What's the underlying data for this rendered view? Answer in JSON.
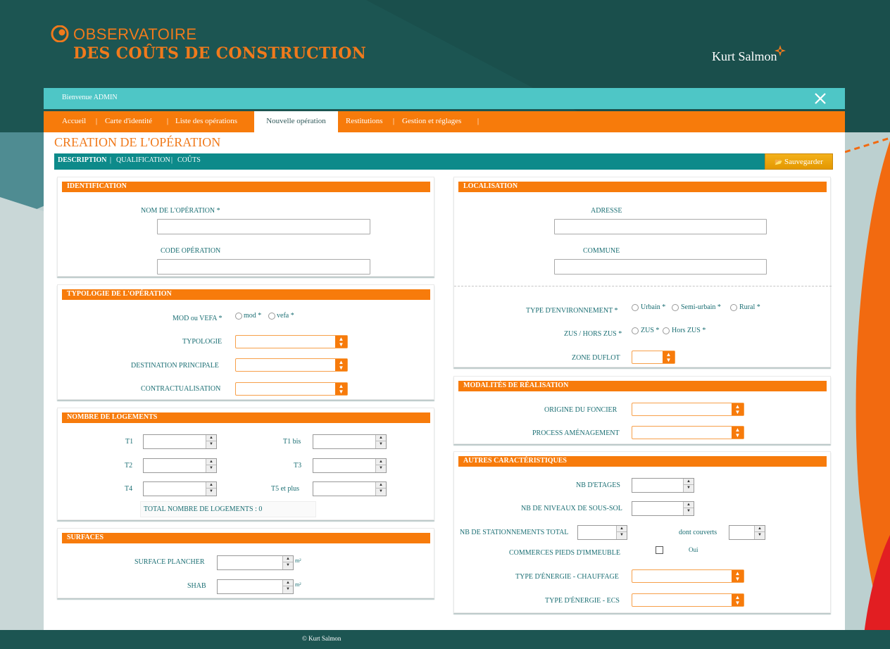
{
  "brand": {
    "line1": "OBSERVATOIRE",
    "line2": "DES COÛTS DE CONSTRUCTION",
    "company": "Kurt Salmon",
    "accent": "#f77b0b",
    "teal": "#0d8a8a"
  },
  "welcome": "Bienvenue ADMIN",
  "nav": {
    "items": [
      "Accueil",
      "Carte d'identité",
      "Liste des opérations",
      "Nouvelle opération",
      "Restitutions",
      "Gestion et réglages"
    ],
    "active": "Nouvelle opération"
  },
  "page_title": "CREATION DE L'OPÉRATION",
  "subnav": [
    "DESCRIPTION",
    "QUALIFICATION",
    "COÛTS"
  ],
  "save_label": "Sauvegarder",
  "identification": {
    "title": "IDENTIFICATION",
    "nom_label": "NOM DE L'OPÉRATION *",
    "code_label": "CODE OPÉRATION"
  },
  "typologie": {
    "title": "TYPOLOGIE DE L'OPÉRATION",
    "mod_label": "MOD ou VEFA *",
    "mod_opt": "mod *",
    "vefa_opt": "vefa *",
    "typologie_label": "TYPOLOGIE",
    "destination_label": "DESTINATION PRINCIPALE",
    "contrat_label": "CONTRACTUALISATION"
  },
  "logements": {
    "title": "NOMBRE DE LOGEMENTS",
    "t1": "T1",
    "t1bis": "T1 bis",
    "t2": "T2",
    "t3": "T3",
    "t4": "T4",
    "t5": "T5 et plus",
    "total": "TOTAL NOMBRE DE LOGEMENTS : 0"
  },
  "surfaces": {
    "title": "SURFACES",
    "plancher": "SURFACE PLANCHER",
    "shab": "SHAB",
    "unit": "m²"
  },
  "localisation": {
    "title": "LOCALISATION",
    "adresse": "ADRESSE",
    "commune": "COMMUNE",
    "env_label": "TYPE D'ENVIRONNEMENT *",
    "env_opts": [
      "Urbain *",
      "Semi-urbain *",
      "Rural *"
    ],
    "zus_label": "ZUS / HORS ZUS *",
    "zus_opts": [
      "ZUS *",
      "Hors ZUS *"
    ],
    "zone_label": "ZONE DUFLOT"
  },
  "modalites": {
    "title": "MODALITÉS DE RÉALISATION",
    "foncier": "ORIGINE DU FONCIER",
    "process": "PROCESS AMÉNAGEMENT"
  },
  "autres": {
    "title": "AUTRES CARACTÉRISTIQUES",
    "etages": "NB D'ETAGES",
    "sous_sol": "NB DE NIVEAUX DE SOUS-SOL",
    "stationnements": "NB DE STATIONNEMENTS TOTAL",
    "couverts": "dont couverts",
    "commerces": "COMMERCES PIEDS D'IMMEUBLE",
    "oui": "Oui",
    "chauffage": "TYPE D'ÉNERGIE - CHAUFFAGE",
    "ecs": "TYPE D'ÉNERGIE - ECS"
  },
  "footer": "© Kurt Salmon"
}
